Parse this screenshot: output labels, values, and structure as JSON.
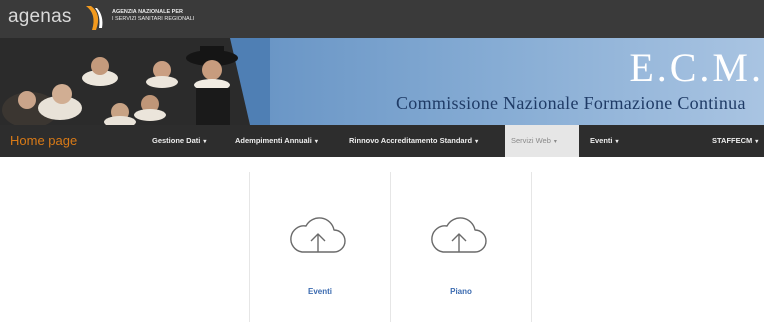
{
  "header": {
    "logo_text": "agenas",
    "agency_line1": "AGENZIA NAZIONALE PER",
    "agency_line2": "I SERVIZI SANITARI REGIONALI"
  },
  "banner": {
    "title": "E.C.M.",
    "subtitle": "Commissione Nazionale Formazione Continua"
  },
  "nav": {
    "home": "Home page",
    "items": [
      {
        "label": "Gestione Dati"
      },
      {
        "label": "Adempimenti Annuali"
      },
      {
        "label": "Rinnovo Accreditamento Standard"
      },
      {
        "label": "Servizi Web"
      },
      {
        "label": "Eventi"
      },
      {
        "label": "STAFFECM"
      }
    ],
    "active": "Servizi Web"
  },
  "tiles": [
    {
      "label": "Eventi",
      "icon": "cloud-upload-icon"
    },
    {
      "label": "Piano",
      "icon": "cloud-upload-icon"
    }
  ],
  "colors": {
    "nav_bg": "#2d2d2d",
    "home_accent": "#d97a17",
    "tile_label": "#3c6bb0"
  }
}
